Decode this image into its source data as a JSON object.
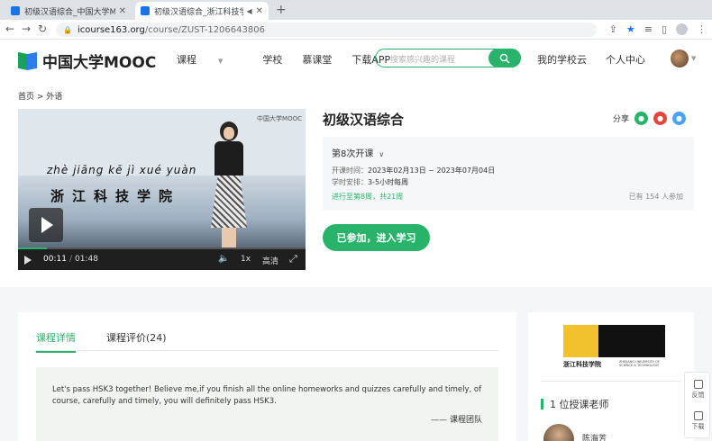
{
  "browser": {
    "tabs": [
      {
        "title": "初级汉语综合_中国大学MOOC(慕",
        "active": false
      },
      {
        "title": "初级汉语综合_浙江科技学院",
        "active": true
      }
    ],
    "url_host": "icourse163.org",
    "url_path": "/course/ZUST-1206643806"
  },
  "header": {
    "logo_text": "中国大学MOOC",
    "nav": [
      "课程",
      "学校",
      "慕课堂",
      "下载APP"
    ],
    "search_placeholder": "搜索感兴趣的课程",
    "links": [
      "我的学校云",
      "个人中心"
    ]
  },
  "breadcrumb": "首页 > 外语",
  "video": {
    "pinyin": "zhè jiāng kē jì xué yuàn",
    "school_text": "浙江科技学院",
    "watermark": "中国大学MOOC",
    "current_time": "00:11",
    "separator": "/",
    "duration": "01:48",
    "speed": "1x",
    "quality": "高清",
    "progress": 0.1
  },
  "course": {
    "title": "初级汉语综合",
    "share_label": "分享",
    "term": "第8次开课",
    "time_label": "开课时间：",
    "time_value": "2023年02月13日 ~ 2023年07月04日",
    "schedule_label": "学时安排：",
    "schedule_value": "3-5小时每周",
    "progress_text": "进行至第8周，共21周",
    "enrolled_text": "已有 154 人参加",
    "join_button": "已参加，进入学习"
  },
  "detail": {
    "tabs": [
      "课程详情",
      "课程评价(24)"
    ],
    "quote_text": "Let's pass HSK3 together! Believe me,if you finish all the online homeworks and quizzes carefully and timely, of course, carefully and timely, you will definitely pass HSK3.",
    "quote_sign": "—— 课程团队"
  },
  "sidebar": {
    "school_logo_cn": "浙江科技学院",
    "school_logo_en": "ZHEJIANG UNIVERSITY OF SCIENCE & TECHNOLOGY",
    "teacher_heading": "1 位授课老师",
    "teacher_name": "陈海芳"
  },
  "floatbar": [
    "反馈",
    "下载"
  ],
  "colors": {
    "accent": "#29b36a",
    "weibo": "#e4443c",
    "qq": "#4aa2f2"
  }
}
